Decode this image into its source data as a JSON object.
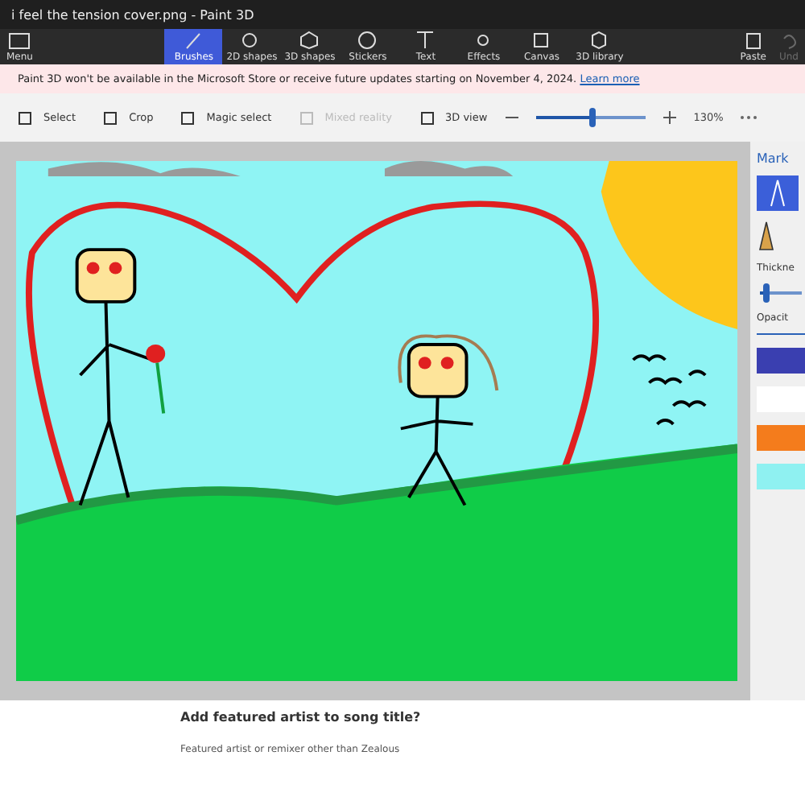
{
  "window": {
    "title": "i feel the tension cover.png - Paint 3D"
  },
  "menu": {
    "label": "Menu"
  },
  "tools": [
    {
      "label": "Brushes",
      "selected": true
    },
    {
      "label": "2D shapes",
      "selected": false
    },
    {
      "label": "3D shapes",
      "selected": false
    },
    {
      "label": "Stickers",
      "selected": false
    },
    {
      "label": "Text",
      "selected": false
    },
    {
      "label": "Effects",
      "selected": false
    },
    {
      "label": "Canvas",
      "selected": false
    },
    {
      "label": "3D library",
      "selected": false
    }
  ],
  "paste": {
    "label": "Paste",
    "disabled": false
  },
  "undo": {
    "label": "Und",
    "disabled": true
  },
  "banner": {
    "text": "Paint 3D won't be available in the Microsoft Store or receive future updates starting on November 4, 2024.",
    "link": "Learn more"
  },
  "commands": [
    {
      "label": "Select",
      "disabled": false
    },
    {
      "label": "Crop",
      "disabled": false
    },
    {
      "label": "Magic select",
      "disabled": false
    },
    {
      "label": "Mixed reality",
      "disabled": true
    },
    {
      "label": "3D view",
      "disabled": false
    }
  ],
  "zoom": {
    "level": 0.52,
    "reading": "130%"
  },
  "panel": {
    "title": "Mark",
    "thickness_label": "Thickne",
    "thickness": {
      "level": 0.15
    },
    "opacity_label": "Opacit",
    "swatches": [
      {
        "color": "#3a3fb0"
      },
      {
        "color": "#ffffff"
      },
      {
        "color": "#f47c1c"
      },
      {
        "color": "#8ff1f1"
      }
    ]
  },
  "page": {
    "heading": "Add featured artist to song title?",
    "hint": "Featured artist or remixer other than Zealous"
  }
}
